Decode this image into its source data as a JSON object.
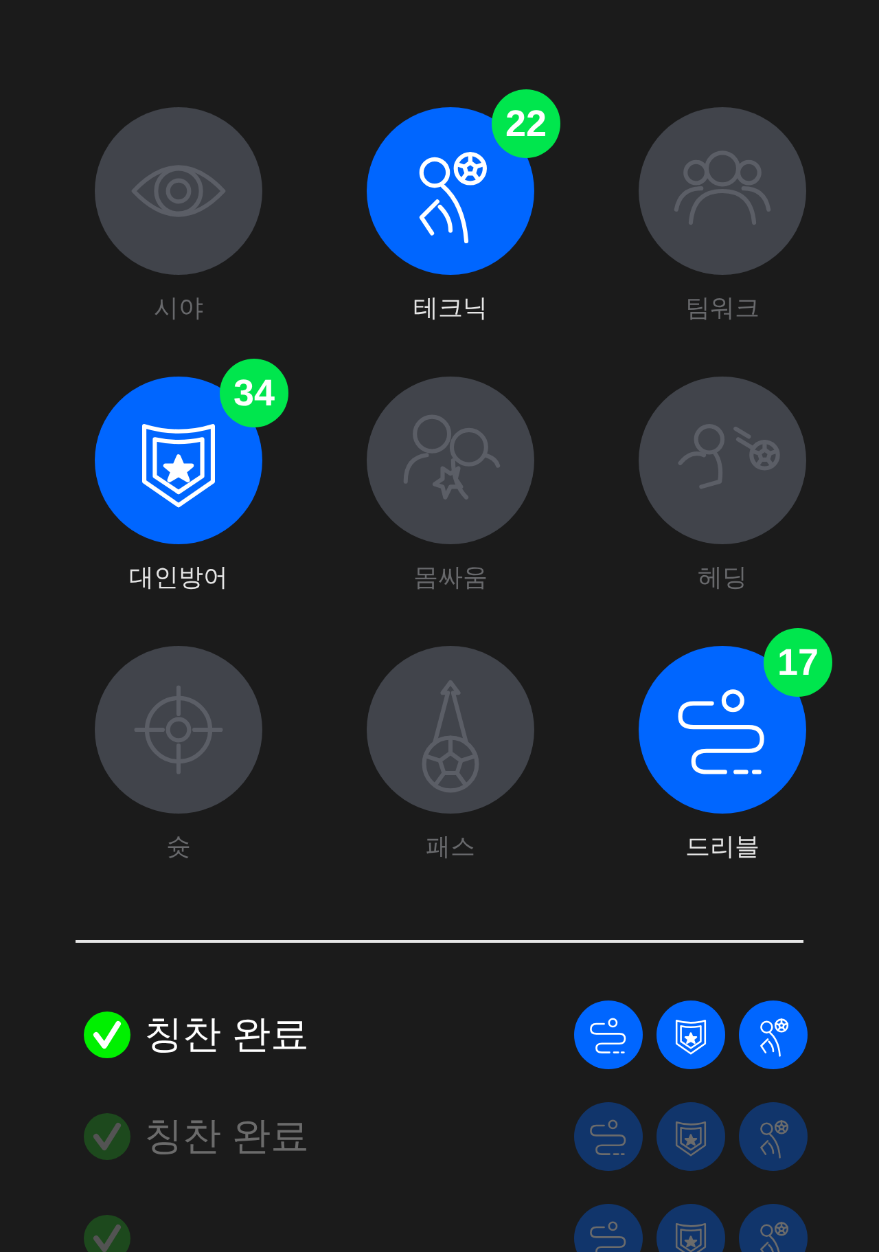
{
  "skills": [
    {
      "label": "시야",
      "kind": "eye",
      "selected": false
    },
    {
      "label": "테크닉",
      "kind": "technique",
      "selected": true,
      "badge": "22"
    },
    {
      "label": "팀워크",
      "kind": "team",
      "selected": false
    },
    {
      "label": "대인방어",
      "kind": "defense",
      "selected": true,
      "badge": "34"
    },
    {
      "label": "몸싸움",
      "kind": "physical",
      "selected": false
    },
    {
      "label": "헤딩",
      "kind": "heading",
      "selected": false
    },
    {
      "label": "슛",
      "kind": "shot",
      "selected": false
    },
    {
      "label": "패스",
      "kind": "pass",
      "selected": false
    },
    {
      "label": "드리블",
      "kind": "dribble",
      "selected": true,
      "badge": "17"
    }
  ],
  "praise": [
    {
      "label": "칭찬 완료",
      "active": true,
      "icons": [
        {
          "kind": "dribble"
        },
        {
          "kind": "defense"
        },
        {
          "kind": "technique"
        }
      ]
    },
    {
      "label": "칭찬 완료",
      "active": false,
      "icons": [
        {
          "kind": "dribble"
        },
        {
          "kind": "defense"
        },
        {
          "kind": "technique"
        }
      ]
    },
    {
      "active": false,
      "icons": [
        {
          "kind": "dribble"
        },
        {
          "kind": "defense"
        },
        {
          "kind": "technique"
        }
      ]
    }
  ]
}
